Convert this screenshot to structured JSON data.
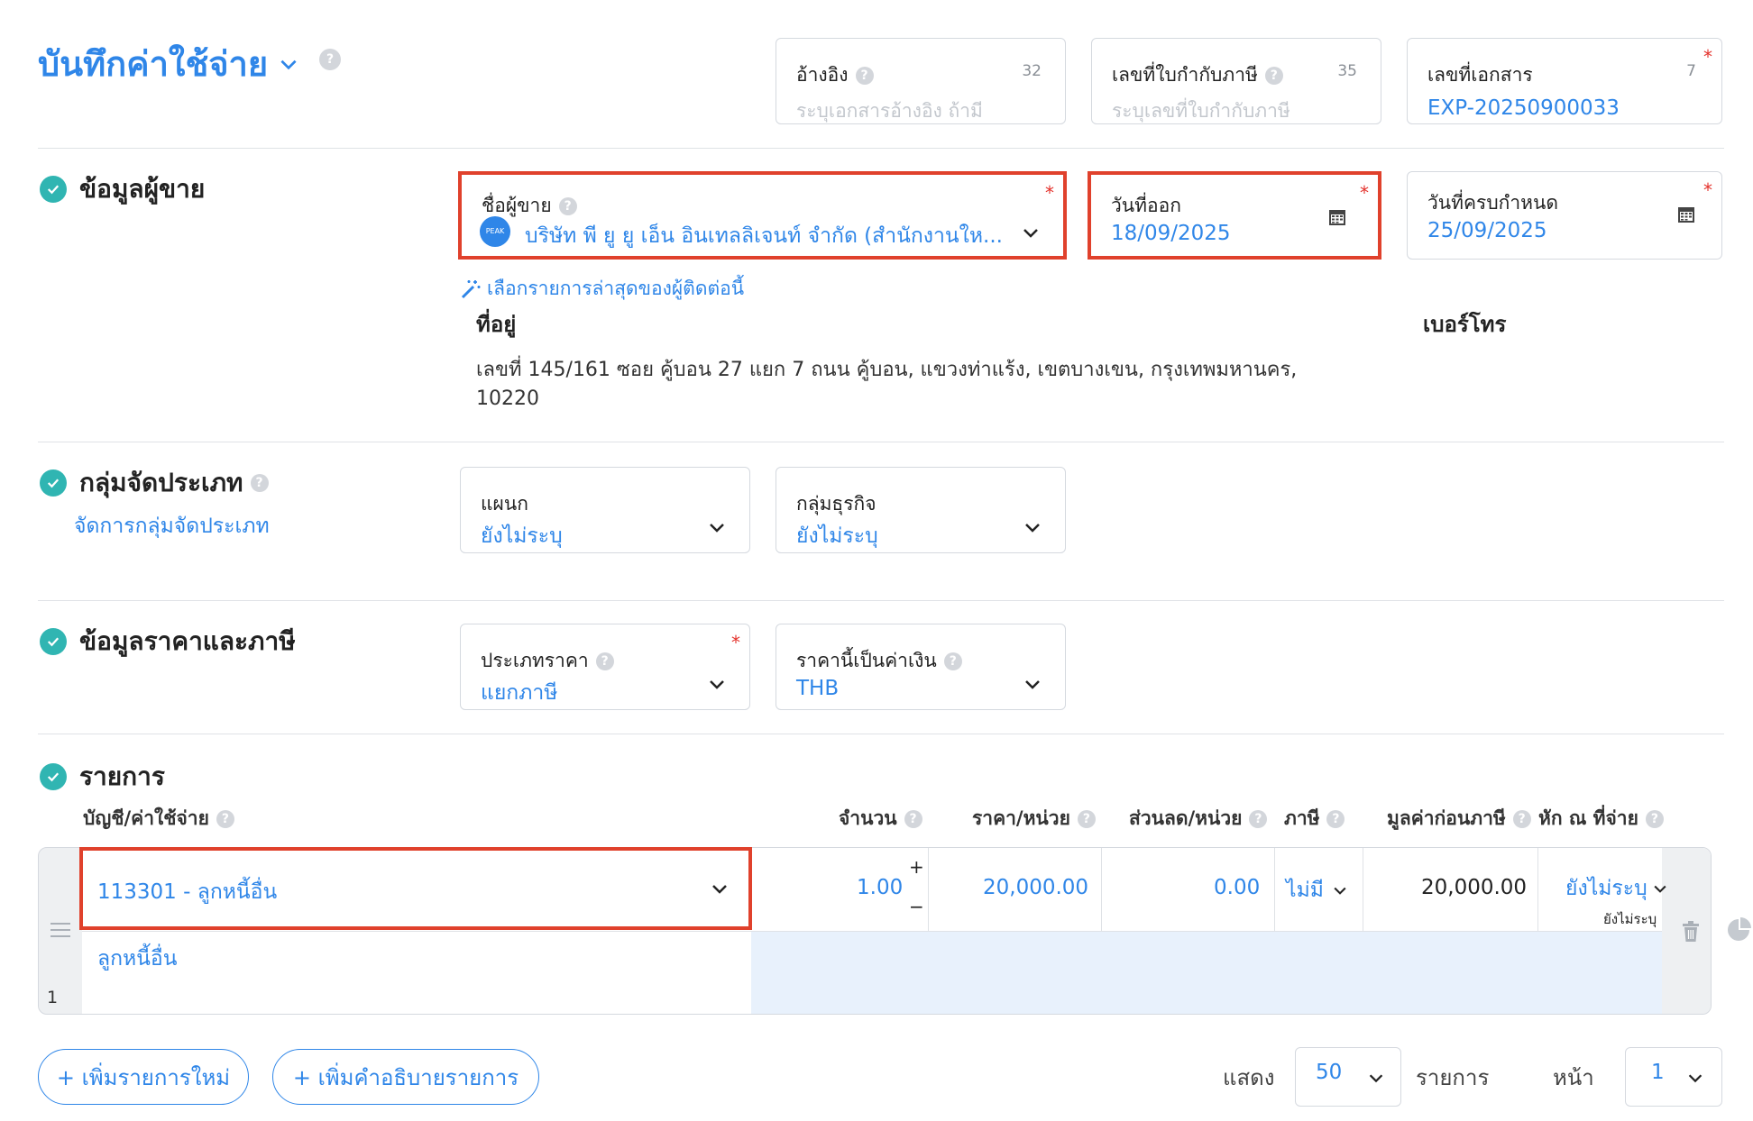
{
  "header": {
    "title": "บันทึกค่าใช้จ่าย"
  },
  "top_fields": {
    "reference": {
      "label": "อ้างอิง",
      "count": "32",
      "placeholder": "ระบุเอกสารอ้างอิง ถ้ามี"
    },
    "tax_invoice": {
      "label": "เลขที่ใบกำกับภาษี",
      "count": "35",
      "placeholder": "ระบุเลขที่ใบกำกับภาษี"
    },
    "doc_no": {
      "label": "เลขที่เอกสาร",
      "count": "7",
      "value": "EXP-20250900033"
    }
  },
  "required_mark": "*",
  "vendor_section": {
    "title": "ข้อมูลผู้ขาย",
    "vendor_label": "ชื่อผู้ขาย",
    "vendor_logo": "PEAK",
    "vendor_value": "บริษัท พี ยู ยู เอ็น อินเทลลิเจนท์ จำกัด (สำนักงานให...",
    "issue_date_label": "วันที่ออก",
    "issue_date": "18/09/2025",
    "due_date_label": "วันที่ครบกำหนด",
    "due_date": "25/09/2025",
    "recent_link": "เลือกรายการล่าสุดของผู้ติดต่อนี้",
    "address_label": "ที่อยู่",
    "address_line1": "เลขที่ 145/161 ซอย คู้บอน 27 แยก 7 ถนน คู้บอน, แขวงท่าแร้ง, เขตบางเขน, กรุงเทพมหานคร,",
    "address_line2": "10220",
    "phone_label": "เบอร์โทร"
  },
  "group_section": {
    "title": "กลุ่มจัดประเภท",
    "manage_link": "จัดการกลุ่มจัดประเภท",
    "department_label": "แผนก",
    "department_value": "ยังไม่ระบุ",
    "business_label": "กลุ่มธุรกิจ",
    "business_value": "ยังไม่ระบุ"
  },
  "price_section": {
    "title": "ข้อมูลราคาและภาษี",
    "price_type_label": "ประเภทราคา",
    "price_type_value": "แยกภาษี",
    "currency_label": "ราคานี้เป็นค่าเงิน",
    "currency_value": "THB"
  },
  "items_section": {
    "title": "รายการ",
    "columns": [
      "บัญชี/ค่าใช้จ่าย",
      "จำนวน",
      "ราคา/หน่วย",
      "ส่วนลด/หน่วย",
      "ภาษี",
      "มูลค่าก่อนภาษี",
      "หัก ณ ที่จ่าย"
    ],
    "rows": [
      {
        "no": "1",
        "account": "113301 - ลูกหนี้อื่น",
        "description": "ลูกหนี้อื่น",
        "qty": "1.00",
        "plus": "+",
        "minus": "−",
        "unit_price": "20,000.00",
        "discount": "0.00",
        "tax": "ไม่มี",
        "pre_tax": "20,000.00",
        "wht": "ยังไม่ระบุ",
        "wht_sub": "ยังไม่ระบุ"
      }
    ]
  },
  "footer": {
    "add_item": "+ เพิ่มรายการใหม่",
    "add_desc": "+ เพิ่มคำอธิบายรายการ",
    "show_label": "แสดง",
    "per_page": "50",
    "items_label": "รายการ",
    "page_label": "หน้า",
    "page": "1"
  },
  "colors": {
    "accent": "#2f86e8",
    "highlight": "#e0412c",
    "check": "#30b5b2"
  }
}
